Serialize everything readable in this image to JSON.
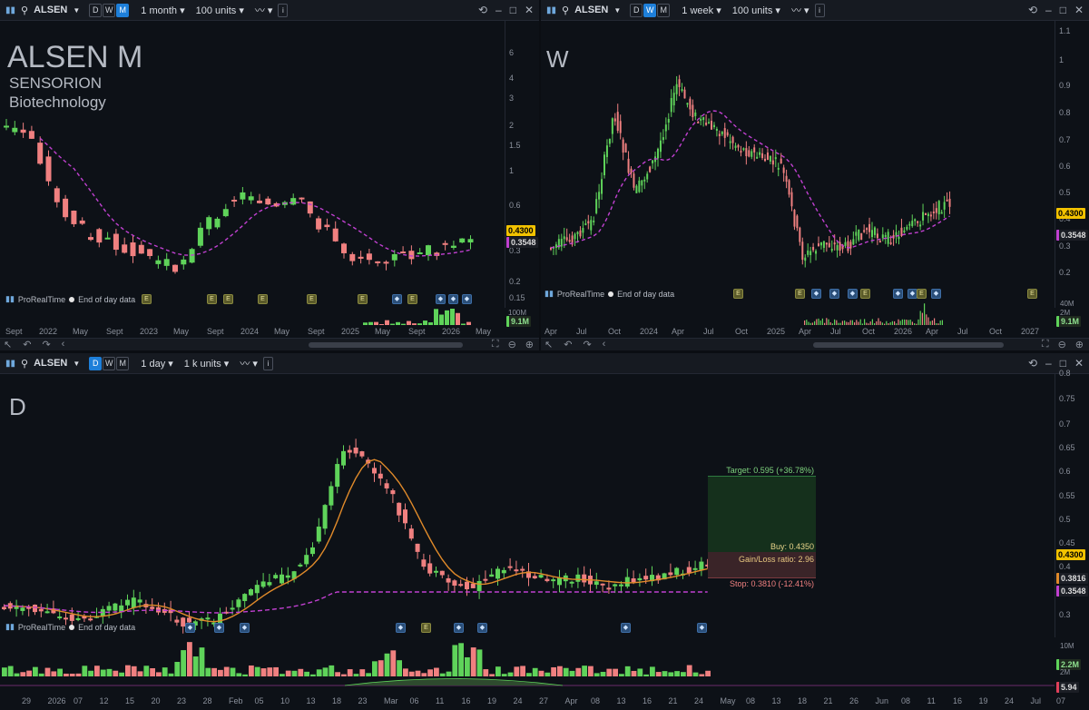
{
  "top_left": {
    "symbol": "ALSEN",
    "periods": [
      "D",
      "W",
      "M"
    ],
    "active_period": "M",
    "timeframe": "1 month",
    "units": "100 units",
    "big_title": "ALSEN  M",
    "company": "SENSORION",
    "sector": "Biotechnology",
    "price_axis": [
      "6",
      "4",
      "3",
      "2",
      "1.5",
      "1",
      "0.6",
      "0.4",
      "0.3",
      "0.2",
      "0.15"
    ],
    "last_price": "0.4300",
    "ma_price": "0.3548",
    "vol_top": "100M",
    "vol_value": "9.1M",
    "date_labels": [
      "Sept",
      "2022",
      "May",
      "Sept",
      "2023",
      "May",
      "Sept",
      "2024",
      "May",
      "Sept",
      "2025",
      "May",
      "Sept",
      "2026",
      "May"
    ],
    "prorealtime": "ProRealTime",
    "eod": "End of day data"
  },
  "top_right": {
    "symbol": "ALSEN",
    "periods": [
      "D",
      "W",
      "M"
    ],
    "active_period": "W",
    "timeframe": "1 week",
    "units": "100 units",
    "big_title": "W",
    "price_axis": [
      "1.1",
      "1",
      "0.9",
      "0.8",
      "0.7",
      "0.6",
      "0.5",
      "0.4",
      "0.3",
      "0.2"
    ],
    "last_price": "0.4300",
    "ma_price": "0.3548",
    "vol_top": "40M",
    "vol_mid": "2M",
    "vol_value": "9.1M",
    "date_labels": [
      "Apr",
      "Jul",
      "Oct",
      "2024",
      "Apr",
      "Jul",
      "Oct",
      "2025",
      "Apr",
      "Jul",
      "Oct",
      "2026",
      "Apr",
      "Jul",
      "Oct",
      "2027"
    ],
    "prorealtime": "ProRealTime",
    "eod": "End of day data"
  },
  "bottom": {
    "symbol": "ALSEN",
    "periods": [
      "D",
      "W",
      "M"
    ],
    "active_period": "D",
    "timeframe": "1 day",
    "units": "1 k units",
    "big_title": "D",
    "price_axis": [
      "0.8",
      "0.75",
      "0.7",
      "0.65",
      "0.6",
      "0.55",
      "0.5",
      "0.45",
      "0.4",
      "0.35",
      "0.3"
    ],
    "last_price": "0.4300",
    "ema_price": "0.3816",
    "ma_price": "0.3548",
    "vol_top": "10M",
    "vol_value": "2.2M",
    "vol_mid": "2M",
    "ind_value": "5.94",
    "target_label": "Target: 0.595 (+36.78%)",
    "buy_label": "Buy: 0.4350",
    "ratio_label": "Gain/Loss ratio: 2.96",
    "stop_label": "Stop: 0.3810 (-12.41%)",
    "date_labels": [
      "29",
      "2026",
      "07",
      "12",
      "15",
      "20",
      "23",
      "28",
      "Feb",
      "05",
      "10",
      "13",
      "18",
      "23",
      "Mar",
      "06",
      "11",
      "16",
      "19",
      "24",
      "27",
      "Apr",
      "08",
      "13",
      "16",
      "21",
      "24",
      "May",
      "08",
      "13",
      "18",
      "21",
      "26",
      "Jun",
      "08",
      "11",
      "16",
      "19",
      "24",
      "Jul",
      "07"
    ],
    "prorealtime": "ProRealTime",
    "eod": "End of day data"
  },
  "colors": {
    "up": "#5fd35a",
    "down": "#f08080",
    "ma": "#c040d0",
    "ema": "#e08a2a",
    "last_price_bg": "#f2c200",
    "accent": "#1e7fd9"
  }
}
